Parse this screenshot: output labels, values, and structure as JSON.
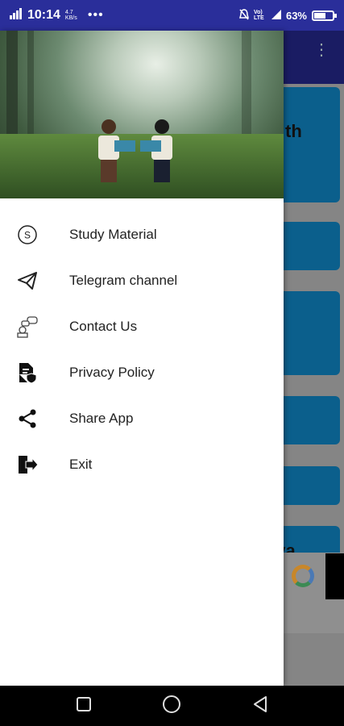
{
  "status_bar": {
    "time": "10:14",
    "small_text": "4.7 KB/s",
    "network": "Vo) LTE",
    "battery": "63%",
    "battery_level": 0.63
  },
  "background": {
    "cards": [
      {
        "text": "th"
      },
      {
        "text": ""
      },
      {
        "text": ""
      },
      {
        "text": ""
      },
      {
        "text": ""
      },
      {
        "text": "aya"
      }
    ]
  },
  "drawer": {
    "items": [
      {
        "label": "Study Material",
        "icon": "s-circle-icon"
      },
      {
        "label": "Telegram channel",
        "icon": "telegram-icon"
      },
      {
        "label": "Contact Us",
        "icon": "contact-icon"
      },
      {
        "label": "Privacy Policy",
        "icon": "privacy-icon"
      },
      {
        "label": "Share App",
        "icon": "share-icon"
      },
      {
        "label": "Exit",
        "icon": "exit-icon"
      }
    ]
  },
  "colors": {
    "status_bar": "#2a2e9a",
    "toolbar": "#1a1c63",
    "card": "#0b5f8c"
  }
}
